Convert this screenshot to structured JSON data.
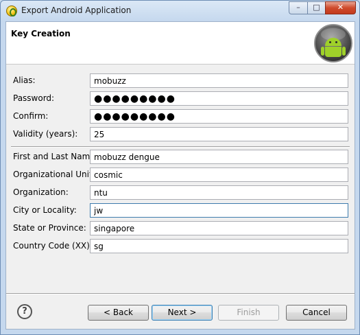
{
  "window": {
    "title": "Export Android Application",
    "minimize": "–",
    "maximize": "□",
    "close": "✕"
  },
  "header": {
    "title": "Key Creation",
    "logo_icon": "android-logo-icon"
  },
  "form": {
    "alias": {
      "label": "Alias:",
      "value": "mobuzz"
    },
    "password": {
      "label": "Password:",
      "value": "●●●●●●●●●"
    },
    "confirm": {
      "label": "Confirm:",
      "value": "●●●●●●●●●"
    },
    "validity": {
      "label": "Validity (years):",
      "value": "25"
    },
    "name": {
      "label": "First and Last Name:",
      "value": "mobuzz dengue"
    },
    "org_unit": {
      "label": "Organizational Unit:",
      "value": "cosmic"
    },
    "organization": {
      "label": "Organization:",
      "value": "ntu"
    },
    "city": {
      "label": "City or Locality:",
      "value": "jw"
    },
    "state": {
      "label": "State or Province:",
      "value": "singapore"
    },
    "country": {
      "label": "Country Code (XX):",
      "value": "sg"
    }
  },
  "footer": {
    "help": "?",
    "back": "< Back",
    "next": "Next >",
    "finish": "Finish",
    "cancel": "Cancel"
  }
}
